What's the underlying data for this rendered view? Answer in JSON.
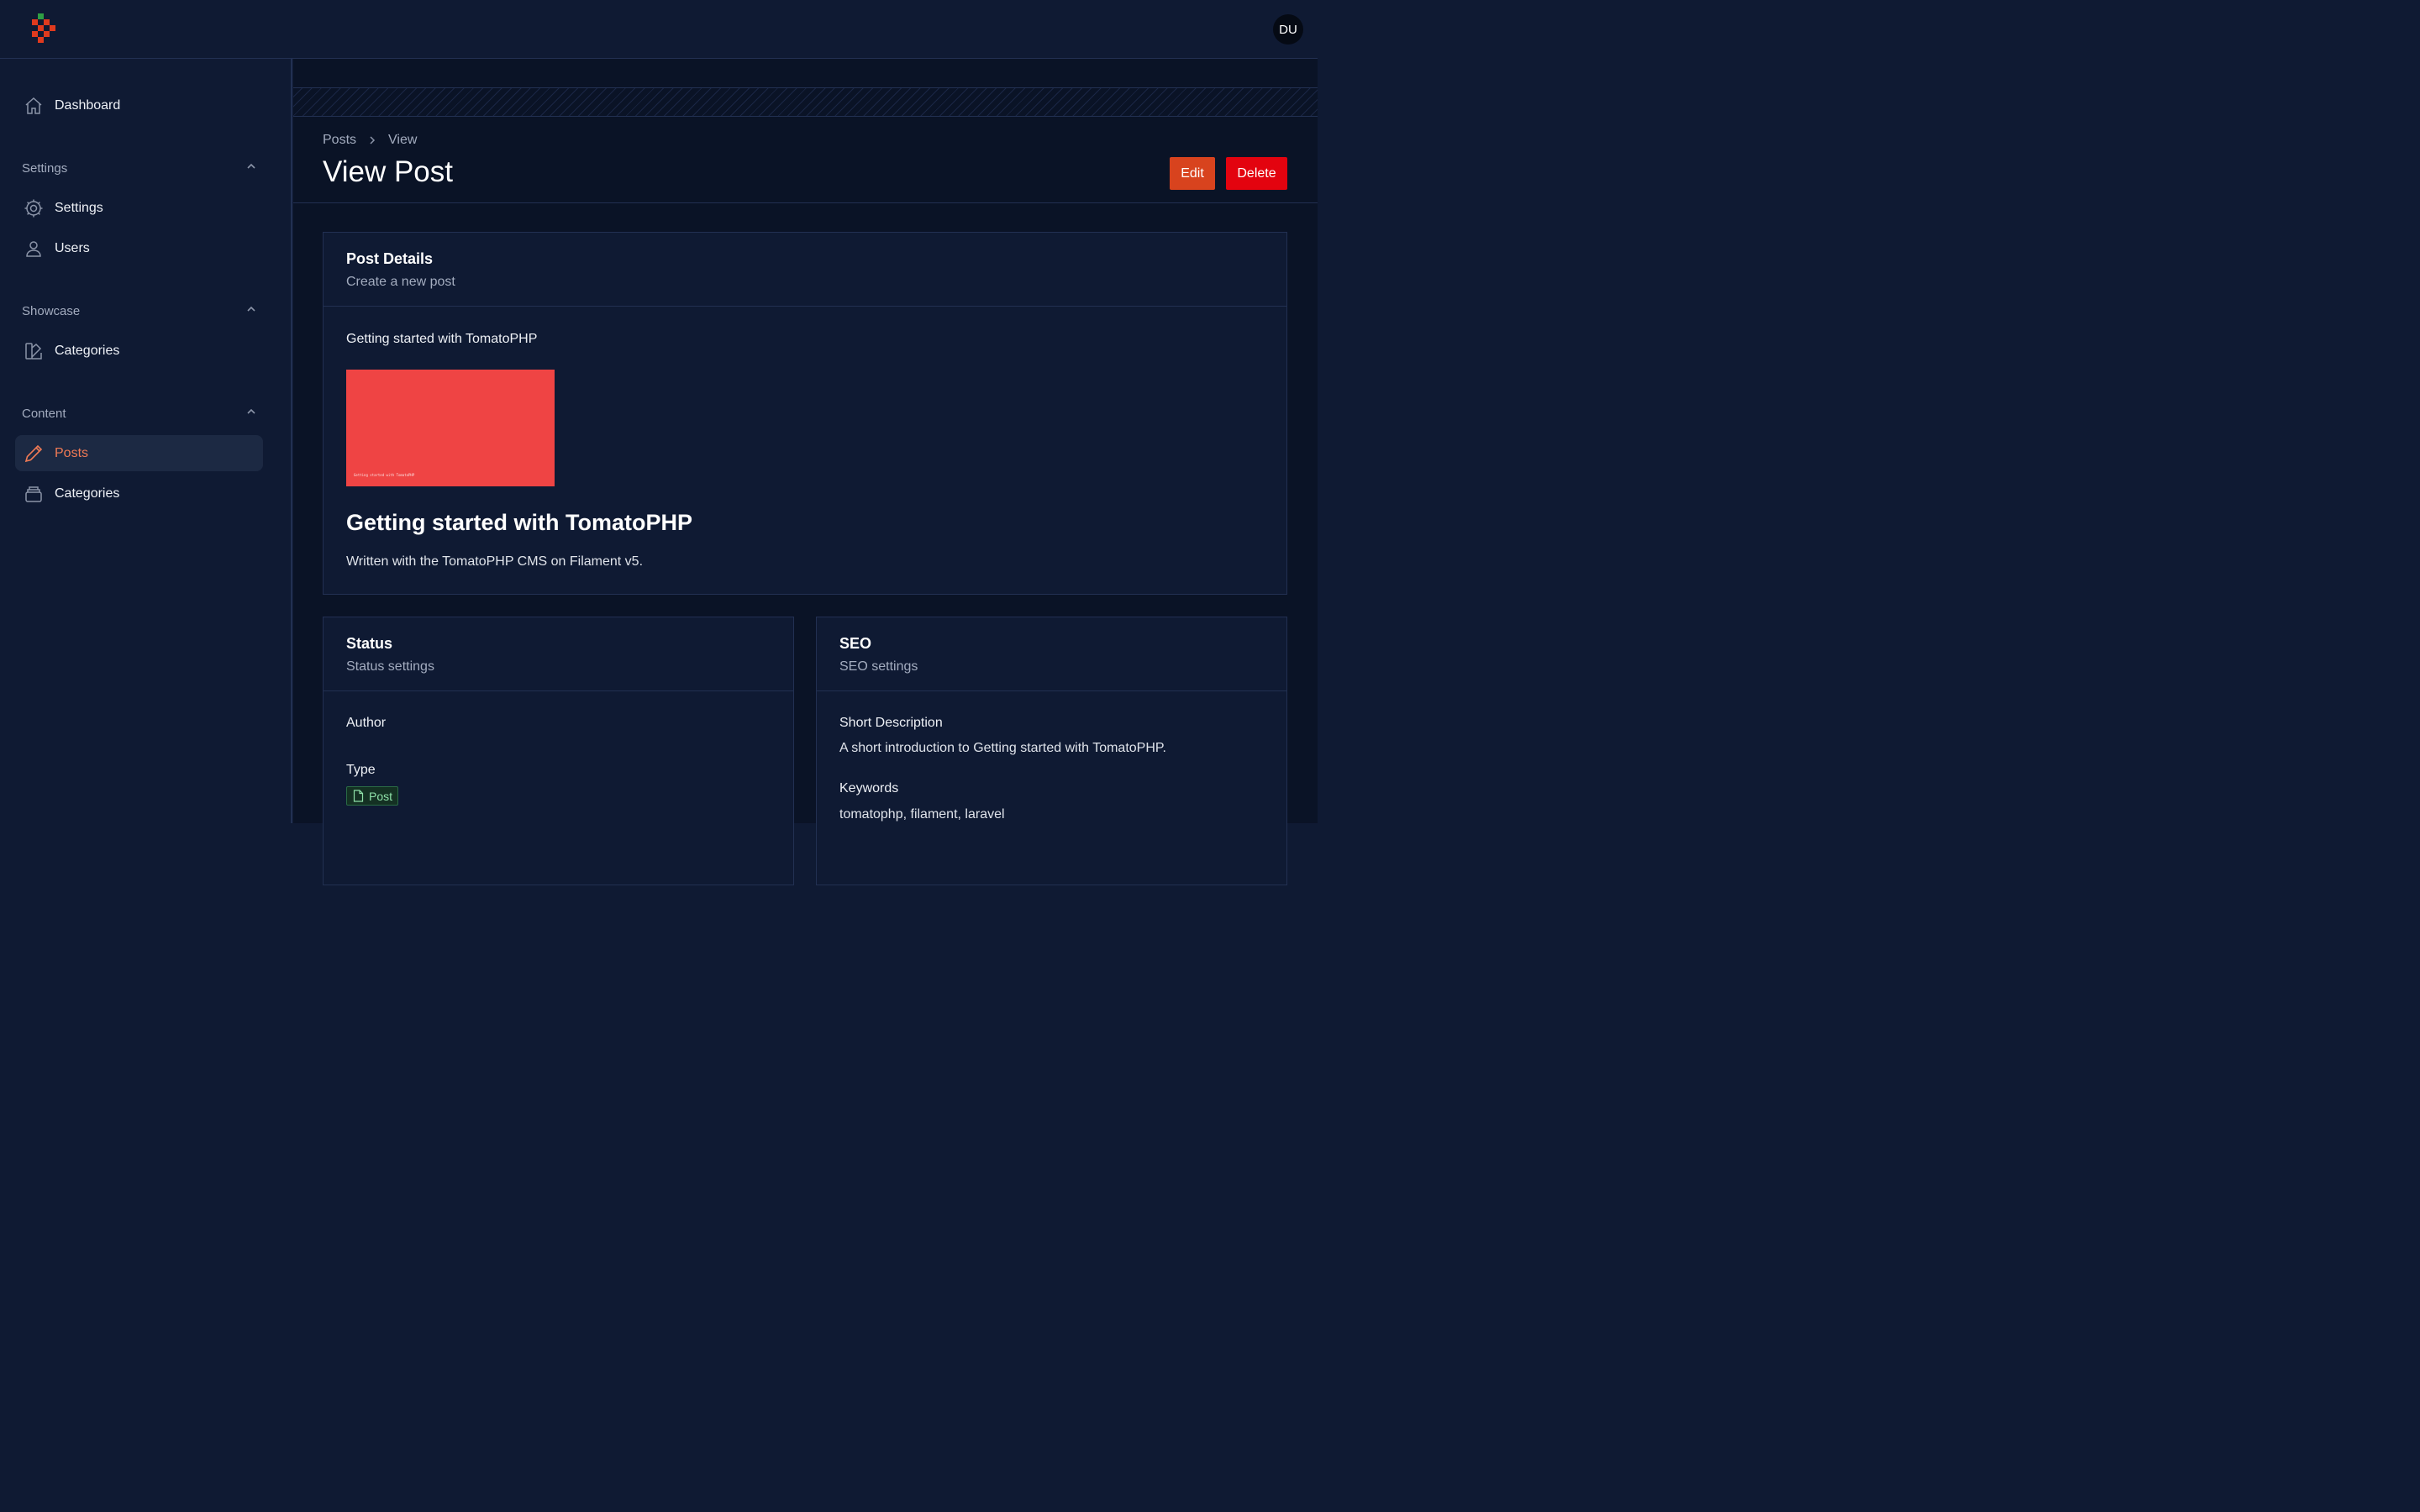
{
  "user": {
    "initials": "DU"
  },
  "sidebar": {
    "dashboard": "Dashboard",
    "groups": [
      {
        "label": "Settings",
        "items": [
          "Settings",
          "Users"
        ]
      },
      {
        "label": "Showcase",
        "items": [
          "Categories"
        ]
      },
      {
        "label": "Content",
        "items": [
          "Posts",
          "Categories"
        ]
      }
    ],
    "active_item": "Posts"
  },
  "header": {
    "breadcrumbs": [
      "Posts",
      "View"
    ],
    "title": "View Post",
    "edit_label": "Edit",
    "delete_label": "Delete"
  },
  "post_details": {
    "title": "Post Details",
    "subtitle": "Create a new post",
    "post_title": "Getting started with TomatoPHP",
    "image_caption": "Getting started with TomatoPHP",
    "heading": "Getting started with TomatoPHP",
    "body": "Written with the TomatoPHP CMS on Filament v5."
  },
  "status": {
    "title": "Status",
    "subtitle": "Status settings",
    "author_label": "Author",
    "type_label": "Type",
    "type_value": "Post"
  },
  "seo": {
    "title": "SEO",
    "subtitle": "SEO settings",
    "short_description_label": "Short Description",
    "short_description": "A short introduction to Getting started with TomatoPHP.",
    "keywords_label": "Keywords",
    "keywords": "tomatophp, filament, laravel"
  },
  "colors": {
    "accent": "#d8431e",
    "danger": "#e3030f",
    "active_text": "#f07a55",
    "image_bg": "#ef4444",
    "badge_text": "#8ee0a8"
  }
}
